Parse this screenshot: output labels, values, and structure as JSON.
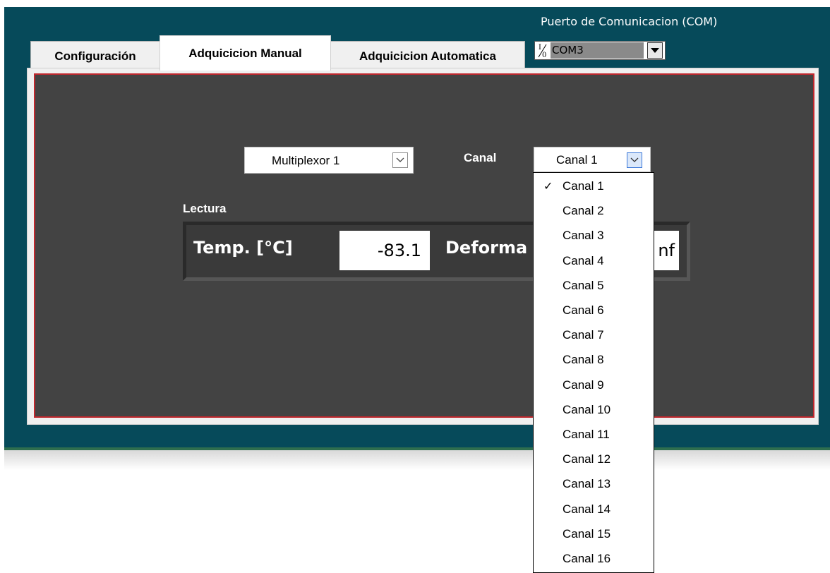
{
  "com_port": {
    "label": "Puerto de Comunicacion (COM)",
    "io_icon": "I/O",
    "value": "COM3"
  },
  "tabs": [
    {
      "label": "Configuración"
    },
    {
      "label": "Adquicicion Manual"
    },
    {
      "label": "Adquicicion Automatica"
    }
  ],
  "active_tab": "Adquicicion Manual",
  "manual": {
    "multiplexor_value": "Multiplexor 1",
    "canal_label": "Canal",
    "canal_value": "Canal 1",
    "lectura_label": "Lectura",
    "temp_label": "Temp. [°C]",
    "temp_value": "-83.1",
    "deform_label": "Deforma",
    "deform_value": "nf"
  },
  "canal_dropdown": {
    "selected": "Canal 1",
    "check_mark": "✓",
    "items": [
      "Canal 1",
      "Canal 2",
      "Canal 3",
      "Canal 4",
      "Canal 5",
      "Canal 6",
      "Canal 7",
      "Canal 8",
      "Canal 9",
      "Canal 10",
      "Canal 11",
      "Canal 12",
      "Canal 13",
      "Canal 14",
      "Canal 15",
      "Canal 16"
    ]
  },
  "colors": {
    "window_bg": "#064a5a",
    "panel_bg": "#434343",
    "panel_border": "#c0272d"
  }
}
